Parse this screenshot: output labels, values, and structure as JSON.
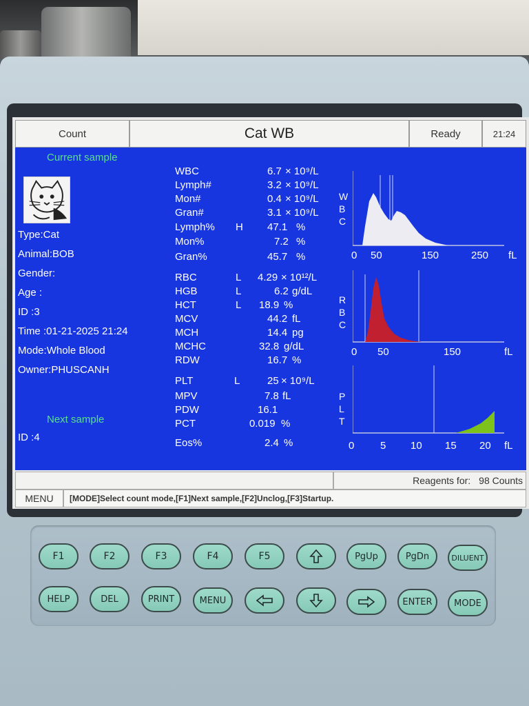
{
  "header": {
    "left_tab": "Count",
    "title": "Cat WB",
    "status": "Ready",
    "time": "21:24"
  },
  "left": {
    "current_sample_label": "Current sample",
    "type": "Type:Cat",
    "animal": "Animal:BOB",
    "gender": "Gender:",
    "age": "Age  :",
    "id": "ID    :3",
    "time": "Time :01-21-2025 21:24",
    "mode": "Mode:Whole Blood",
    "owner": "Owner:PHUSCANH",
    "next_sample_label": "Next sample",
    "next_id": "ID    :4"
  },
  "params": [
    {
      "name": "WBC",
      "flag": "",
      "value": "6.7",
      "unit": "× 10⁹/L"
    },
    {
      "name": "Lymph#",
      "flag": "",
      "value": "3.2",
      "unit": "× 10⁹/L"
    },
    {
      "name": "Mon#",
      "flag": "",
      "value": "0.4",
      "unit": "× 10⁹/L"
    },
    {
      "name": "Gran#",
      "flag": "",
      "value": "3.1",
      "unit": "× 10⁹/L"
    },
    {
      "name": "Lymph%",
      "flag": "H",
      "value": "47.1",
      "unit": "%"
    },
    {
      "name": "Mon%",
      "flag": "",
      "value": "7.2",
      "unit": "%"
    },
    {
      "name": "Gran%",
      "flag": "",
      "value": "45.7",
      "unit": "%"
    },
    {
      "name": "RBC",
      "flag": "L",
      "value": "4.29",
      "unit": "× 10¹²/L"
    },
    {
      "name": "HGB",
      "flag": "L",
      "value": "6.2",
      "unit": "g/dL"
    },
    {
      "name": "HCT",
      "flag": "L",
      "value": "18.9",
      "unit": "%"
    },
    {
      "name": "MCV",
      "flag": "",
      "value": "44.2",
      "unit": "fL"
    },
    {
      "name": "MCH",
      "flag": "",
      "value": "14.4",
      "unit": "pg"
    },
    {
      "name": "MCHC",
      "flag": "",
      "value": "32.8",
      "unit": "g/dL"
    },
    {
      "name": "RDW",
      "flag": "",
      "value": "16.7",
      "unit": "%"
    },
    {
      "name": "PLT",
      "flag": "L",
      "value": "25",
      "unit": "× 10⁹/L"
    },
    {
      "name": "MPV",
      "flag": "",
      "value": "7.8",
      "unit": "fL"
    },
    {
      "name": "PDW",
      "flag": "",
      "value": "16.1",
      "unit": ""
    },
    {
      "name": "PCT",
      "flag": "",
      "value": "0.019",
      "unit": "%"
    },
    {
      "name": "Eos%",
      "flag": "",
      "value": "2.4",
      "unit": "%"
    }
  ],
  "histograms": {
    "wbc": {
      "label": [
        "W",
        "B",
        "C"
      ],
      "ticks": [
        "0",
        "50",
        "150",
        "250"
      ],
      "unit": "fL",
      "fill": "#e9e9ee"
    },
    "rbc": {
      "label": [
        "R",
        "B",
        "C"
      ],
      "ticks": [
        "0",
        "50",
        "150"
      ],
      "unit": "fL",
      "fill": "#c0202f"
    },
    "plt": {
      "label": [
        "P",
        "L",
        "T"
      ],
      "ticks": [
        "0",
        "5",
        "10",
        "15",
        "20"
      ],
      "unit": "fL",
      "fill": "#7cc21a"
    }
  },
  "footer": {
    "reagents_label": "Reagents for:",
    "reagents_count": "98 Counts",
    "menu": "MENU",
    "help_text": "[MODE]Select count mode,[F1]Next sample,[F2]Unclog,[F3]Startup."
  },
  "keys": {
    "f1": "F1",
    "f2": "F2",
    "f3": "F3",
    "f4": "F4",
    "f5": "F5",
    "pgup": "PgUp",
    "pgdn": "PgDn",
    "diluent": "DILUENT",
    "help": "HELP",
    "del": "DEL",
    "print": "PRINT",
    "menu": "MENU",
    "enter": "ENTER",
    "mode": "MODE"
  },
  "colors": {
    "screen_blue": "#1736e0",
    "label_green": "#58e08c",
    "key_green": "#9edac9"
  }
}
